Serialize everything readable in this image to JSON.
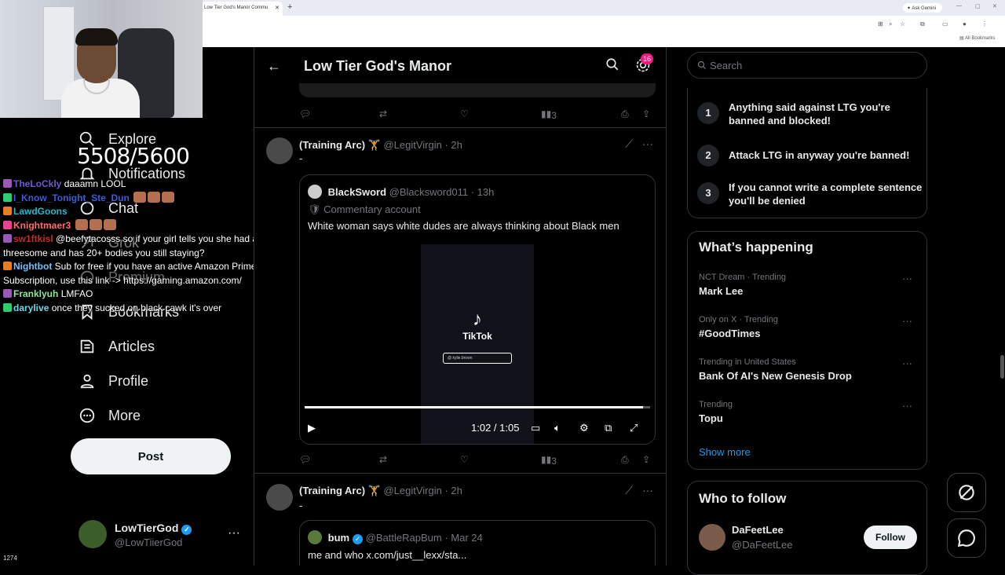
{
  "browser": {
    "tab_title": "Low Tier God's Manor Commu",
    "new_tab": "+",
    "ask_gemini": "Ask Gemini",
    "all_bookmarks": "All Bookmarks"
  },
  "overlay": {
    "counter": "5508/5600",
    "viewers": "1274",
    "chat": [
      {
        "user": "TheLoCkly",
        "user_color": "#6a5acd",
        "msg": "daaamn LOOL",
        "emotes": 0
      },
      {
        "user": "I_Know_Tonight_Ste_Dun",
        "user_color": "#3b5bdb",
        "msg": "",
        "emotes": 3
      },
      {
        "user": "LawdGoons",
        "user_color": "#22b8cf",
        "msg": "",
        "emotes": 0
      },
      {
        "user": "Knightmaer3",
        "user_color": "#ff6b6b",
        "msg": "",
        "emotes": 3
      },
      {
        "user": "sw1ftkisl",
        "user_color": "#c92a2a",
        "msg": "@beefytacosss so if your girl tells you she had a",
        "emotes": 0
      },
      {
        "user": "",
        "user_color": "#fff",
        "msg": "threesome and has 20+ bodies you still staying?",
        "emotes": 0
      },
      {
        "user": "Nightbot",
        "user_color": "#74c0fc",
        "msg": "Sub for free if you have an active Amazon Prime",
        "emotes": 0
      },
      {
        "user": "",
        "user_color": "#fff",
        "msg": "Subscription, use this link -> https://gaming.amazon.com/",
        "emotes": 0
      },
      {
        "user": "Franklyuh",
        "user_color": "#8ce99a",
        "msg": "LMFAO",
        "emotes": 0
      },
      {
        "user": "darylive",
        "user_color": "#66d9e8",
        "msg": "once they sucked on black cawk it's over",
        "emotes": 0
      }
    ]
  },
  "nav": {
    "explore": "Explore",
    "notifications": "Notifications",
    "chat": "Chat",
    "grok": "Grok",
    "premium": "Premium",
    "bookmarks": "Bookmarks",
    "articles": "Articles",
    "profile": "Profile",
    "more": "More",
    "post": "Post"
  },
  "account": {
    "name": "LowTierGod",
    "handle": "@LowTiierGod",
    "more": "···"
  },
  "header": {
    "title": "Low Tier God's Manor",
    "notif_count": "16"
  },
  "tweet0": {
    "views": "3"
  },
  "tweet1": {
    "name": "(Training Arc) 🏋",
    "handle": "@LegitVirgin",
    "time": "· 2h",
    "text": "-",
    "views": "3",
    "quote": {
      "name": "BlackSword",
      "handle": "@Blacksword011",
      "time": "· 13h",
      "label": "Commentary account",
      "text": "White woman says white dudes are always thinking about Black men",
      "video": {
        "brand": "TikTok",
        "search_handle": "@ kylie.brown",
        "time": "1:02 / 1:05",
        "progress": 0.98
      }
    }
  },
  "tweet2": {
    "name": "(Training Arc) 🏋",
    "handle": "@LegitVirgin",
    "time": "· 2h",
    "text": "-",
    "quote": {
      "name": "bum",
      "handle": "@BattleRapBum",
      "time": "· Mar 24",
      "text": "me and who  x.com/just__lexx/sta..."
    }
  },
  "sidebar": {
    "search_placeholder": "Search",
    "rules": [
      {
        "num": "1",
        "text": "Anything said against LTG you're banned and blocked!"
      },
      {
        "num": "2",
        "text": "Attack LTG in anyway you're banned!"
      },
      {
        "num": "3",
        "text": "If you cannot write a complete sentence you'll be denied"
      }
    ],
    "happening_title": "What’s happening",
    "trends": [
      {
        "context": "NCT Dream · Trending",
        "title": "Mark Lee"
      },
      {
        "context": "Only on X · Trending",
        "title": "#GoodTimes"
      },
      {
        "context": "Trending in United States",
        "title": "Bank Of AI's New Genesis Drop"
      },
      {
        "context": "Trending",
        "title": "Topu"
      }
    ],
    "show_more": "Show more",
    "who_to_follow": "Who to follow",
    "suggest": {
      "name": "DaFeetLee",
      "handle": "@DaFeetLee",
      "follow": "Follow"
    }
  },
  "colors": {
    "accent": "#1d9bf0",
    "notif": "#f91880"
  }
}
